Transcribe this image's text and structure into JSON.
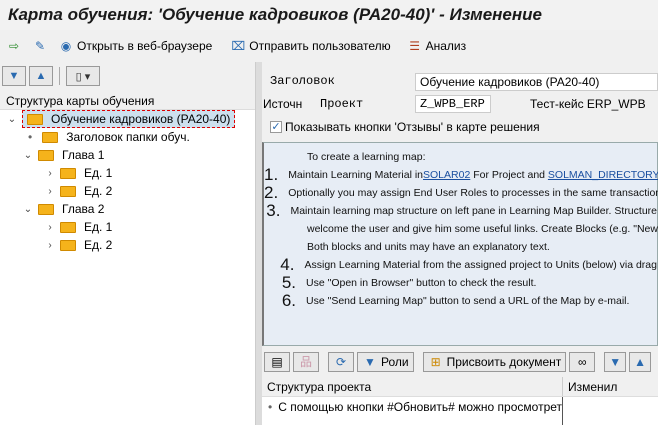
{
  "title": "Карта обучения: 'Обучение кадровиков (PA20-40)' - Изменение",
  "toolbar": {
    "open_browser": "Открыть в веб-браузере",
    "send_user": "Отправить пользователю",
    "analysis": "Анализ"
  },
  "tree": {
    "header": "Структура карты обучения",
    "items": [
      {
        "label": "Обучение кадровиков (PA20-40)"
      },
      {
        "label": "Заголовок папки обуч."
      },
      {
        "label": "Глава 1"
      },
      {
        "label": "Ед. 1"
      },
      {
        "label": "Ед. 2"
      },
      {
        "label": "Глава 2"
      },
      {
        "label": "Ед. 1"
      },
      {
        "label": "Ед. 2"
      }
    ]
  },
  "form": {
    "title_label": "Заголовок",
    "title_value": "Обучение кадровиков (PA20-40)",
    "source_label": "Источн",
    "project_label": "Проект",
    "project_value": "Z_WPB_ERP",
    "testcase": "Тест-кейс ERP_WPB",
    "feedback_checkbox": "Показывать кнопки 'Отзывы' в карте решения"
  },
  "info": {
    "intro": "To create a learning map:",
    "steps": [
      {
        "n": "1.",
        "pre": "Maintain Learning Material in ",
        "link1": "SOLAR02",
        "mid": " For Project and ",
        "link2": "SOLMAN_DIRECTORY"
      },
      {
        "n": "2.",
        "text": "Optionally you may assign End User Roles to processes in the same transaction."
      },
      {
        "n": "3.",
        "text": "Maintain learning map structure on left pane in Learning Map Builder. Structure",
        "cont1": "welcome the user and give him some useful links. Create Blocks (e.g. \"New",
        "cont2": "Both blocks and units may have an explanatory text."
      },
      {
        "n": "4.",
        "text": "Assign Learning Material from the assigned project to Units (below) via drag"
      },
      {
        "n": "5.",
        "text": "Use \"Open in Browser\" button to check the result."
      },
      {
        "n": "6.",
        "text": "Use \"Send Learning Map\" button to send a URL of the Map by e-mail."
      }
    ]
  },
  "bottom": {
    "roles": "Роли",
    "assign_doc": "Присвоить документ",
    "col_structure": "Структура проекта",
    "col_changed": "Изменил",
    "row_text": "С помощью кнопки #Обновить# можно просмотреть"
  }
}
